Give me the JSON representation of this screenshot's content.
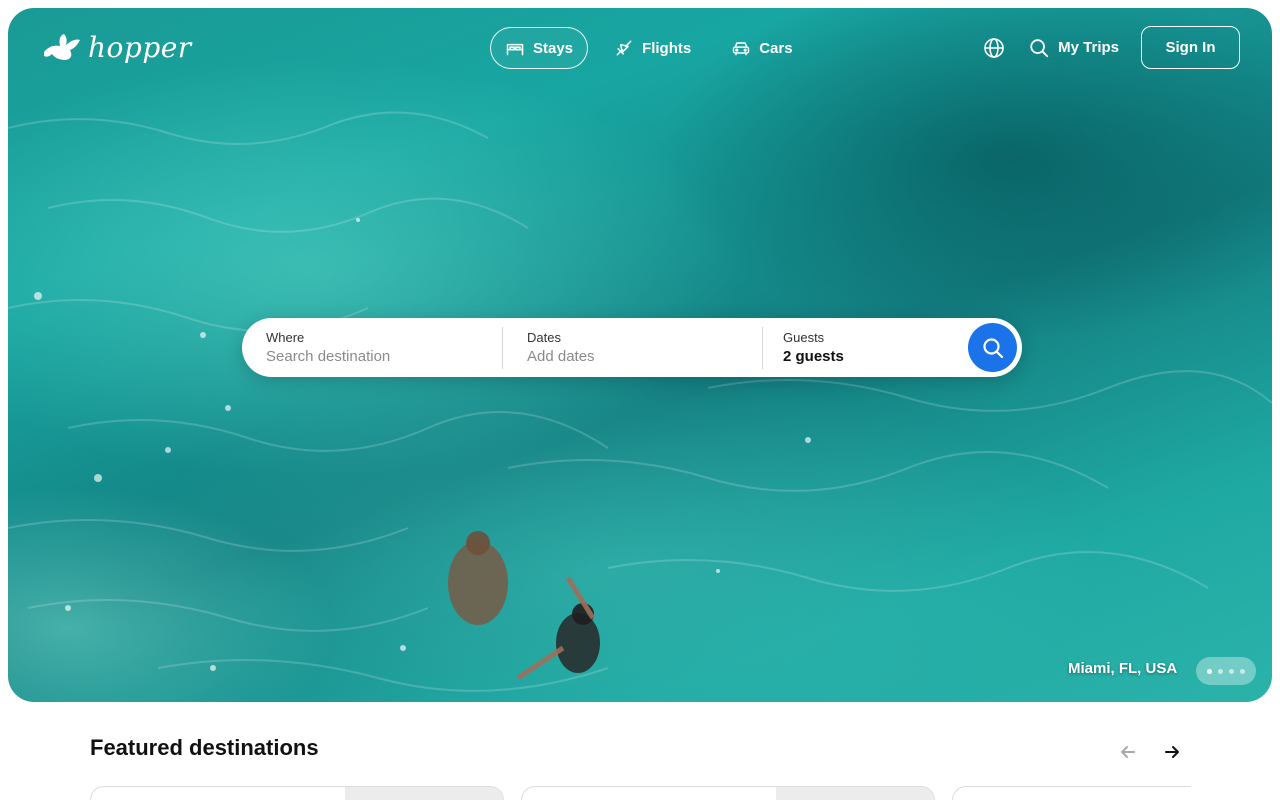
{
  "brand": {
    "name": "hopper"
  },
  "nav": {
    "items": [
      {
        "label": "Stays",
        "icon": "bed-icon",
        "active": true
      },
      {
        "label": "Flights",
        "icon": "plane-icon",
        "active": false
      },
      {
        "label": "Cars",
        "icon": "car-icon",
        "active": false
      }
    ],
    "language_icon": "globe-icon",
    "my_trips_label": "My Trips",
    "sign_in_label": "Sign In"
  },
  "search": {
    "where_label": "Where",
    "where_placeholder": "Search destination",
    "dates_label": "Dates",
    "dates_placeholder": "Add dates",
    "guests_label": "Guests",
    "guests_value": "2 guests",
    "button_icon": "search-icon",
    "accent_color": "#1a73e8"
  },
  "hero": {
    "location": "Miami, FL, USA",
    "slide_count": 4,
    "active_slide": 1
  },
  "featured": {
    "title": "Featured destinations"
  }
}
